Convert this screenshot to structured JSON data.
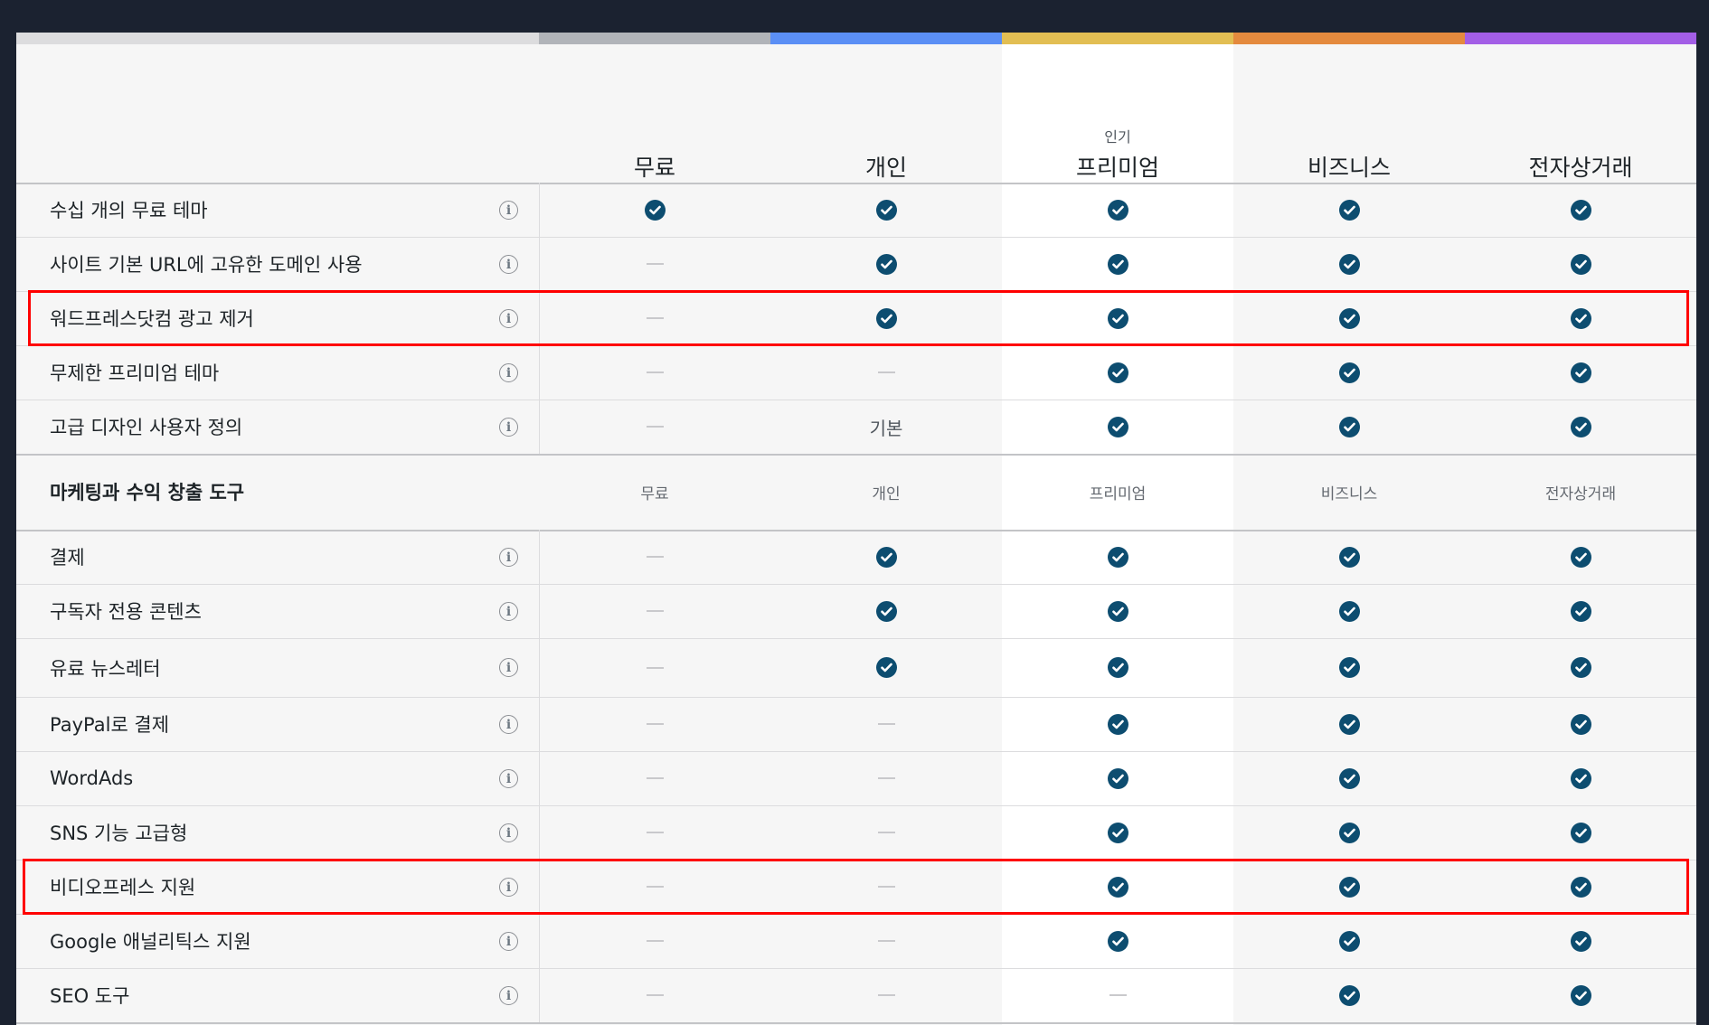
{
  "plans": [
    {
      "name": "무료",
      "badge": "",
      "color": "#b1b4b9"
    },
    {
      "name": "개인",
      "badge": "",
      "color": "#5b8ff5"
    },
    {
      "name": "프리미엄",
      "badge": "인기",
      "color": "#e2be53"
    },
    {
      "name": "비즈니스",
      "badge": "",
      "color": "#e48a3e"
    },
    {
      "name": "전자상거래",
      "badge": "",
      "color": "#a35ee6"
    }
  ],
  "features_top": [
    {
      "label": "수십 개의 무료 테마",
      "values": [
        "check",
        "check",
        "check",
        "check",
        "check"
      ]
    },
    {
      "label": "사이트 기본 URL에 고유한 도메인 사용",
      "values": [
        "dash",
        "check",
        "check",
        "check",
        "check"
      ]
    },
    {
      "label": "워드프레스닷컴 광고 제거",
      "values": [
        "dash",
        "check",
        "check",
        "check",
        "check"
      ],
      "highlighted": true
    },
    {
      "label": "무제한 프리미엄 테마",
      "values": [
        "dash",
        "dash",
        "check",
        "check",
        "check"
      ]
    },
    {
      "label": "고급 디자인 사용자 정의",
      "values": [
        "dash",
        "기본",
        "check",
        "check",
        "check"
      ]
    }
  ],
  "section": {
    "title": "마케팅과 수익 창출 도구",
    "columns": [
      "무료",
      "개인",
      "프리미엄",
      "비즈니스",
      "전자상거래"
    ]
  },
  "features_marketing": [
    {
      "label": "결제",
      "values": [
        "dash",
        "check",
        "check",
        "check",
        "check"
      ]
    },
    {
      "label": "구독자 전용 콘텐츠",
      "values": [
        "dash",
        "check",
        "check",
        "check",
        "check"
      ]
    },
    {
      "label": "유료 뉴스레터",
      "values": [
        "dash",
        "check",
        "check",
        "check",
        "check"
      ]
    },
    {
      "label": "PayPal로 결제",
      "values": [
        "dash",
        "dash",
        "check",
        "check",
        "check"
      ]
    },
    {
      "label": "WordAds",
      "values": [
        "dash",
        "dash",
        "check",
        "check",
        "check"
      ]
    },
    {
      "label": "SNS 기능 고급형",
      "values": [
        "dash",
        "dash",
        "check",
        "check",
        "check"
      ]
    },
    {
      "label": "비디오프레스 지원",
      "values": [
        "dash",
        "dash",
        "check",
        "check",
        "check"
      ],
      "highlighted": true
    },
    {
      "label": "Google 애널리틱스 지원",
      "values": [
        "dash",
        "dash",
        "check",
        "check",
        "check"
      ]
    },
    {
      "label": "SEO 도구",
      "values": [
        "dash",
        "dash",
        "dash",
        "check",
        "check"
      ]
    }
  ],
  "icons": {
    "included": "check-circle-icon",
    "not_included": "dash-icon",
    "info": "info-icon"
  },
  "colors": {
    "check": "#0d4d70",
    "highlight": "#ff0000",
    "background": "#1b2230"
  }
}
